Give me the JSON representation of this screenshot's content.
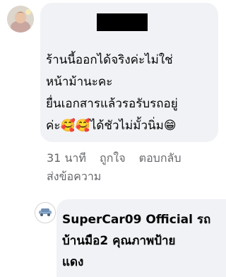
{
  "comment": {
    "text": "ร้านนี้ออกได้จริงค่ะไม่ใช่\nหน้าม้านะคะ\nยื่นเอกสารแล้วรอรับรถอยู่\nค่ะ🥰🥰ได้ชัวไม่มั้วนิ่ม😁",
    "timestamp": "31 นาที",
    "like_label": "ถูกใจ",
    "reply_label": "ตอบกลับ",
    "send_message_label": "ส่งข้อความ"
  },
  "reply": {
    "author_and_text": "SuperCar09 Official รถ\nบ้านมือ2 คุณภาพป้าย\nแดง"
  },
  "colors": {
    "bubble_background": "#f0f2f5",
    "primary_text": "#050505",
    "secondary_text": "#65676b",
    "redaction": "#000000"
  }
}
